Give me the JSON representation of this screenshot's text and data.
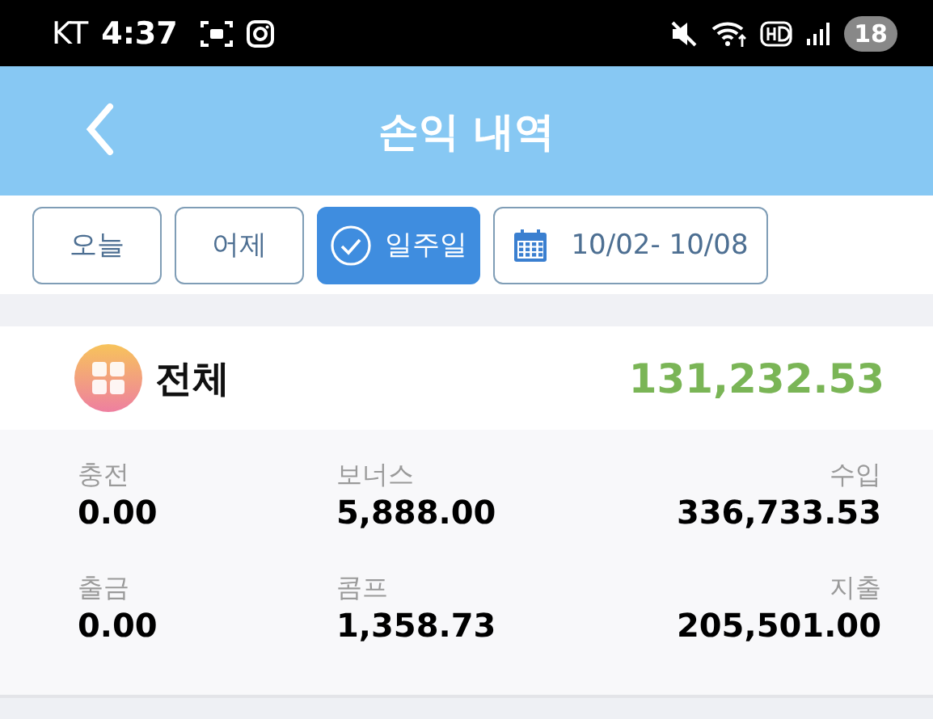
{
  "status_bar": {
    "carrier": "KT",
    "time": "4:37",
    "battery": "18"
  },
  "header": {
    "title": "손익 내역"
  },
  "filters": [
    {
      "kind": "tab",
      "label": "오늘",
      "selected": false
    },
    {
      "kind": "tab",
      "label": "어제",
      "selected": false
    },
    {
      "kind": "tab",
      "label": "일주일",
      "selected": true
    },
    {
      "kind": "date",
      "label": "10/02- 10/08"
    }
  ],
  "total": {
    "label": "전체",
    "amount": "131,232.53"
  },
  "stats": [
    {
      "label": "충전",
      "value": "0.00"
    },
    {
      "label": "보너스",
      "value": "5,888.00"
    },
    {
      "label": "수입",
      "value": "336,733.53"
    },
    {
      "label": "출금",
      "value": "0.00"
    },
    {
      "label": "콤프",
      "value": "1,358.73"
    },
    {
      "label": "지출",
      "value": "205,501.00"
    }
  ]
}
